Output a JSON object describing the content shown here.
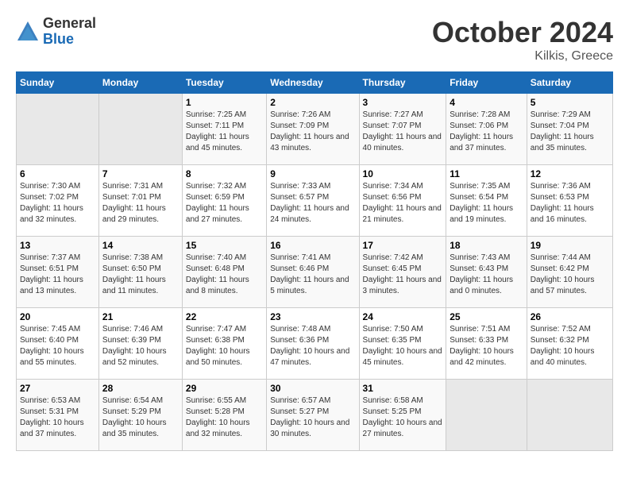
{
  "header": {
    "logo_general": "General",
    "logo_blue": "Blue",
    "month_title": "October 2024",
    "subtitle": "Kilkis, Greece"
  },
  "weekdays": [
    "Sunday",
    "Monday",
    "Tuesday",
    "Wednesday",
    "Thursday",
    "Friday",
    "Saturday"
  ],
  "weeks": [
    [
      {
        "day": "",
        "empty": true
      },
      {
        "day": "",
        "empty": true
      },
      {
        "day": "1",
        "sunrise": "Sunrise: 7:25 AM",
        "sunset": "Sunset: 7:11 PM",
        "daylight": "Daylight: 11 hours and 45 minutes."
      },
      {
        "day": "2",
        "sunrise": "Sunrise: 7:26 AM",
        "sunset": "Sunset: 7:09 PM",
        "daylight": "Daylight: 11 hours and 43 minutes."
      },
      {
        "day": "3",
        "sunrise": "Sunrise: 7:27 AM",
        "sunset": "Sunset: 7:07 PM",
        "daylight": "Daylight: 11 hours and 40 minutes."
      },
      {
        "day": "4",
        "sunrise": "Sunrise: 7:28 AM",
        "sunset": "Sunset: 7:06 PM",
        "daylight": "Daylight: 11 hours and 37 minutes."
      },
      {
        "day": "5",
        "sunrise": "Sunrise: 7:29 AM",
        "sunset": "Sunset: 7:04 PM",
        "daylight": "Daylight: 11 hours and 35 minutes."
      }
    ],
    [
      {
        "day": "6",
        "sunrise": "Sunrise: 7:30 AM",
        "sunset": "Sunset: 7:02 PM",
        "daylight": "Daylight: 11 hours and 32 minutes."
      },
      {
        "day": "7",
        "sunrise": "Sunrise: 7:31 AM",
        "sunset": "Sunset: 7:01 PM",
        "daylight": "Daylight: 11 hours and 29 minutes."
      },
      {
        "day": "8",
        "sunrise": "Sunrise: 7:32 AM",
        "sunset": "Sunset: 6:59 PM",
        "daylight": "Daylight: 11 hours and 27 minutes."
      },
      {
        "day": "9",
        "sunrise": "Sunrise: 7:33 AM",
        "sunset": "Sunset: 6:57 PM",
        "daylight": "Daylight: 11 hours and 24 minutes."
      },
      {
        "day": "10",
        "sunrise": "Sunrise: 7:34 AM",
        "sunset": "Sunset: 6:56 PM",
        "daylight": "Daylight: 11 hours and 21 minutes."
      },
      {
        "day": "11",
        "sunrise": "Sunrise: 7:35 AM",
        "sunset": "Sunset: 6:54 PM",
        "daylight": "Daylight: 11 hours and 19 minutes."
      },
      {
        "day": "12",
        "sunrise": "Sunrise: 7:36 AM",
        "sunset": "Sunset: 6:53 PM",
        "daylight": "Daylight: 11 hours and 16 minutes."
      }
    ],
    [
      {
        "day": "13",
        "sunrise": "Sunrise: 7:37 AM",
        "sunset": "Sunset: 6:51 PM",
        "daylight": "Daylight: 11 hours and 13 minutes."
      },
      {
        "day": "14",
        "sunrise": "Sunrise: 7:38 AM",
        "sunset": "Sunset: 6:50 PM",
        "daylight": "Daylight: 11 hours and 11 minutes."
      },
      {
        "day": "15",
        "sunrise": "Sunrise: 7:40 AM",
        "sunset": "Sunset: 6:48 PM",
        "daylight": "Daylight: 11 hours and 8 minutes."
      },
      {
        "day": "16",
        "sunrise": "Sunrise: 7:41 AM",
        "sunset": "Sunset: 6:46 PM",
        "daylight": "Daylight: 11 hours and 5 minutes."
      },
      {
        "day": "17",
        "sunrise": "Sunrise: 7:42 AM",
        "sunset": "Sunset: 6:45 PM",
        "daylight": "Daylight: 11 hours and 3 minutes."
      },
      {
        "day": "18",
        "sunrise": "Sunrise: 7:43 AM",
        "sunset": "Sunset: 6:43 PM",
        "daylight": "Daylight: 11 hours and 0 minutes."
      },
      {
        "day": "19",
        "sunrise": "Sunrise: 7:44 AM",
        "sunset": "Sunset: 6:42 PM",
        "daylight": "Daylight: 10 hours and 57 minutes."
      }
    ],
    [
      {
        "day": "20",
        "sunrise": "Sunrise: 7:45 AM",
        "sunset": "Sunset: 6:40 PM",
        "daylight": "Daylight: 10 hours and 55 minutes."
      },
      {
        "day": "21",
        "sunrise": "Sunrise: 7:46 AM",
        "sunset": "Sunset: 6:39 PM",
        "daylight": "Daylight: 10 hours and 52 minutes."
      },
      {
        "day": "22",
        "sunrise": "Sunrise: 7:47 AM",
        "sunset": "Sunset: 6:38 PM",
        "daylight": "Daylight: 10 hours and 50 minutes."
      },
      {
        "day": "23",
        "sunrise": "Sunrise: 7:48 AM",
        "sunset": "Sunset: 6:36 PM",
        "daylight": "Daylight: 10 hours and 47 minutes."
      },
      {
        "day": "24",
        "sunrise": "Sunrise: 7:50 AM",
        "sunset": "Sunset: 6:35 PM",
        "daylight": "Daylight: 10 hours and 45 minutes."
      },
      {
        "day": "25",
        "sunrise": "Sunrise: 7:51 AM",
        "sunset": "Sunset: 6:33 PM",
        "daylight": "Daylight: 10 hours and 42 minutes."
      },
      {
        "day": "26",
        "sunrise": "Sunrise: 7:52 AM",
        "sunset": "Sunset: 6:32 PM",
        "daylight": "Daylight: 10 hours and 40 minutes."
      }
    ],
    [
      {
        "day": "27",
        "sunrise": "Sunrise: 6:53 AM",
        "sunset": "Sunset: 5:31 PM",
        "daylight": "Daylight: 10 hours and 37 minutes."
      },
      {
        "day": "28",
        "sunrise": "Sunrise: 6:54 AM",
        "sunset": "Sunset: 5:29 PM",
        "daylight": "Daylight: 10 hours and 35 minutes."
      },
      {
        "day": "29",
        "sunrise": "Sunrise: 6:55 AM",
        "sunset": "Sunset: 5:28 PM",
        "daylight": "Daylight: 10 hours and 32 minutes."
      },
      {
        "day": "30",
        "sunrise": "Sunrise: 6:57 AM",
        "sunset": "Sunset: 5:27 PM",
        "daylight": "Daylight: 10 hours and 30 minutes."
      },
      {
        "day": "31",
        "sunrise": "Sunrise: 6:58 AM",
        "sunset": "Sunset: 5:25 PM",
        "daylight": "Daylight: 10 hours and 27 minutes."
      },
      {
        "day": "",
        "empty": true
      },
      {
        "day": "",
        "empty": true
      }
    ]
  ]
}
